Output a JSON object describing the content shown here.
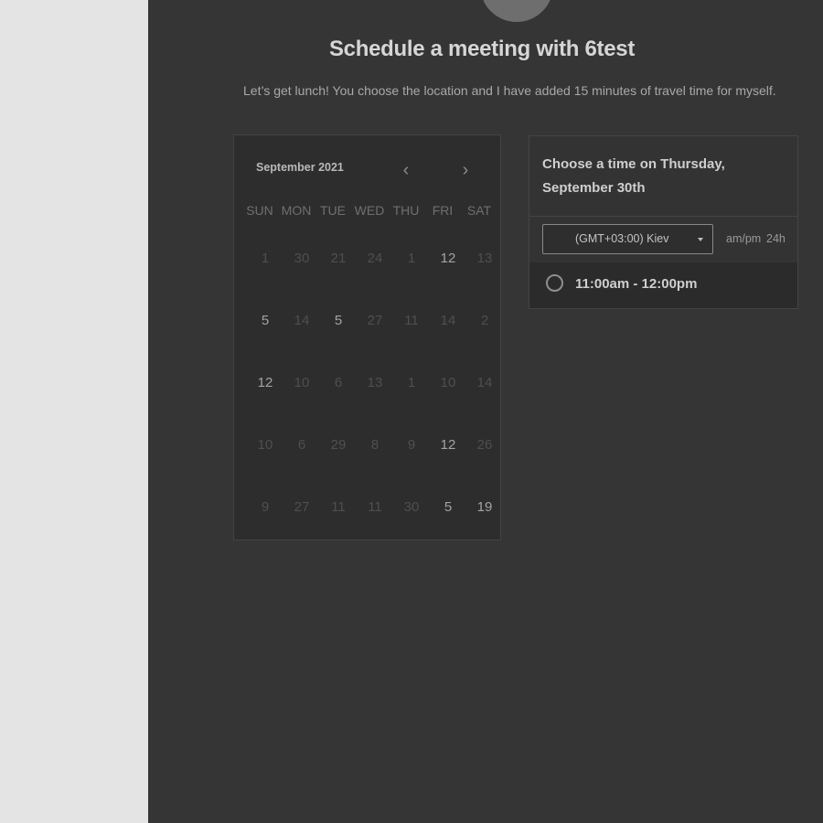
{
  "header": {
    "title": "Schedule a meeting with 6test",
    "subtitle": "Let’s get lunch! You choose the location and I have added 15 minutes of travel time for myself."
  },
  "calendar": {
    "month_label": "September 2021",
    "prev_icon": "chevron-left-icon",
    "next_icon": "chevron-right-icon",
    "prev_glyph": "‹",
    "next_glyph": "›",
    "weekdays": [
      "SUN",
      "MON",
      "TUE",
      "WED",
      "THU",
      "FRI",
      "SAT"
    ],
    "days": [
      {
        "label": "1",
        "available": false
      },
      {
        "label": "30",
        "available": false
      },
      {
        "label": "21",
        "available": false
      },
      {
        "label": "24",
        "available": false
      },
      {
        "label": "1",
        "available": false
      },
      {
        "label": "12",
        "available": true
      },
      {
        "label": "13",
        "available": false
      },
      {
        "label": "5",
        "available": true
      },
      {
        "label": "14",
        "available": false
      },
      {
        "label": "5",
        "available": true
      },
      {
        "label": "27",
        "available": false
      },
      {
        "label": "11",
        "available": false
      },
      {
        "label": "14",
        "available": false
      },
      {
        "label": "2",
        "available": false
      },
      {
        "label": "12",
        "available": true
      },
      {
        "label": "10",
        "available": false
      },
      {
        "label": "6",
        "available": false
      },
      {
        "label": "13",
        "available": false
      },
      {
        "label": "1",
        "available": false
      },
      {
        "label": "10",
        "available": false
      },
      {
        "label": "14",
        "available": false
      },
      {
        "label": "10",
        "available": false
      },
      {
        "label": "6",
        "available": false
      },
      {
        "label": "29",
        "available": false
      },
      {
        "label": "8",
        "available": false
      },
      {
        "label": "9",
        "available": false
      },
      {
        "label": "12",
        "available": true
      },
      {
        "label": "26",
        "available": false
      },
      {
        "label": "9",
        "available": false
      },
      {
        "label": "27",
        "available": false
      },
      {
        "label": "11",
        "available": false
      },
      {
        "label": "11",
        "available": false
      },
      {
        "label": "30",
        "available": false
      },
      {
        "label": "5",
        "available": true
      },
      {
        "label": "19",
        "available": true
      }
    ]
  },
  "times": {
    "heading": "Choose a time on Thursday, September 30th",
    "timezone": "(GMT+03:00) Kiev",
    "format_ampm": "am/pm",
    "format_24h": "24h",
    "slots": [
      {
        "label": "11:00am - 12:00pm"
      }
    ]
  },
  "colors": {
    "background": "#353535",
    "gutter": "#e4e4e4",
    "card": "#2d2d2d"
  }
}
